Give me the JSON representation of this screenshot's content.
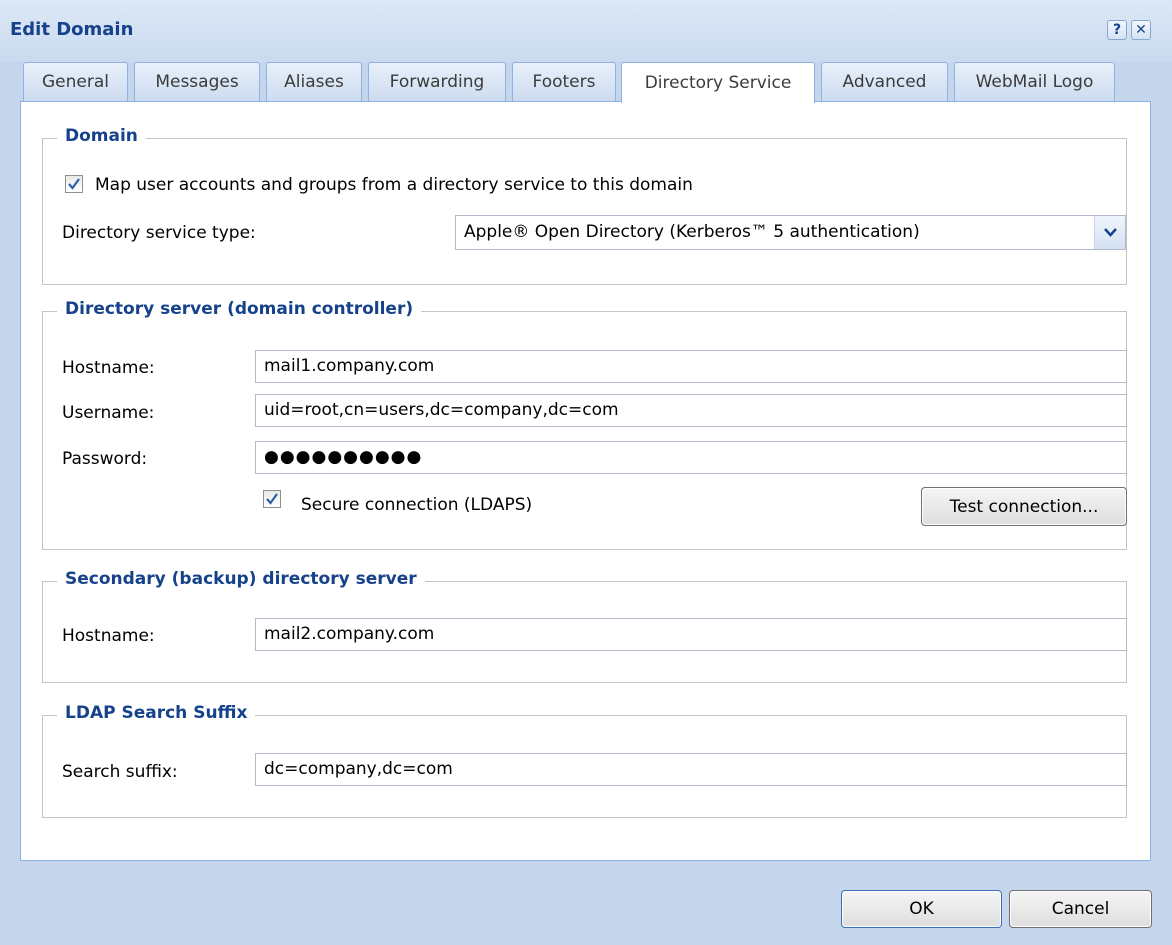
{
  "window": {
    "title": "Edit Domain",
    "help_glyph": "?",
    "close_glyph": "✕"
  },
  "tabs": [
    {
      "label": "General"
    },
    {
      "label": "Messages"
    },
    {
      "label": "Aliases"
    },
    {
      "label": "Forwarding"
    },
    {
      "label": "Footers"
    },
    {
      "label": "Directory Service"
    },
    {
      "label": "Advanced"
    },
    {
      "label": "WebMail Logo"
    }
  ],
  "active_tab": "Directory Service",
  "domain_group": {
    "legend": "Domain",
    "map_checkbox_label": "Map user accounts and groups from a directory service to this domain",
    "map_checked": true,
    "service_type_label": "Directory service type:",
    "service_type_value": "Apple® Open Directory (Kerberos™ 5 authentication)"
  },
  "server_group": {
    "legend": "Directory server (domain controller)",
    "hostname_label": "Hostname:",
    "hostname_value": "mail1.company.com",
    "username_label": "Username:",
    "username_value": "uid=root,cn=users,dc=company,dc=com",
    "password_label": "Password:",
    "password_value": "●●●●●●●●●●",
    "secure_label": "Secure connection (LDAPS)",
    "secure_checked": true,
    "test_button": "Test connection..."
  },
  "secondary_group": {
    "legend": "Secondary (backup) directory server",
    "hostname_label": "Hostname:",
    "hostname_value": "mail2.company.com"
  },
  "ldap_group": {
    "legend": "LDAP Search Suffix",
    "suffix_label": "Search suffix:",
    "suffix_value": "dc=company,dc=com"
  },
  "footer": {
    "ok_label": "OK",
    "cancel_label": "Cancel"
  },
  "colors": {
    "accent": "#15428b",
    "window_bg": "#c5d6ec",
    "tab_border": "#8db2e3"
  }
}
